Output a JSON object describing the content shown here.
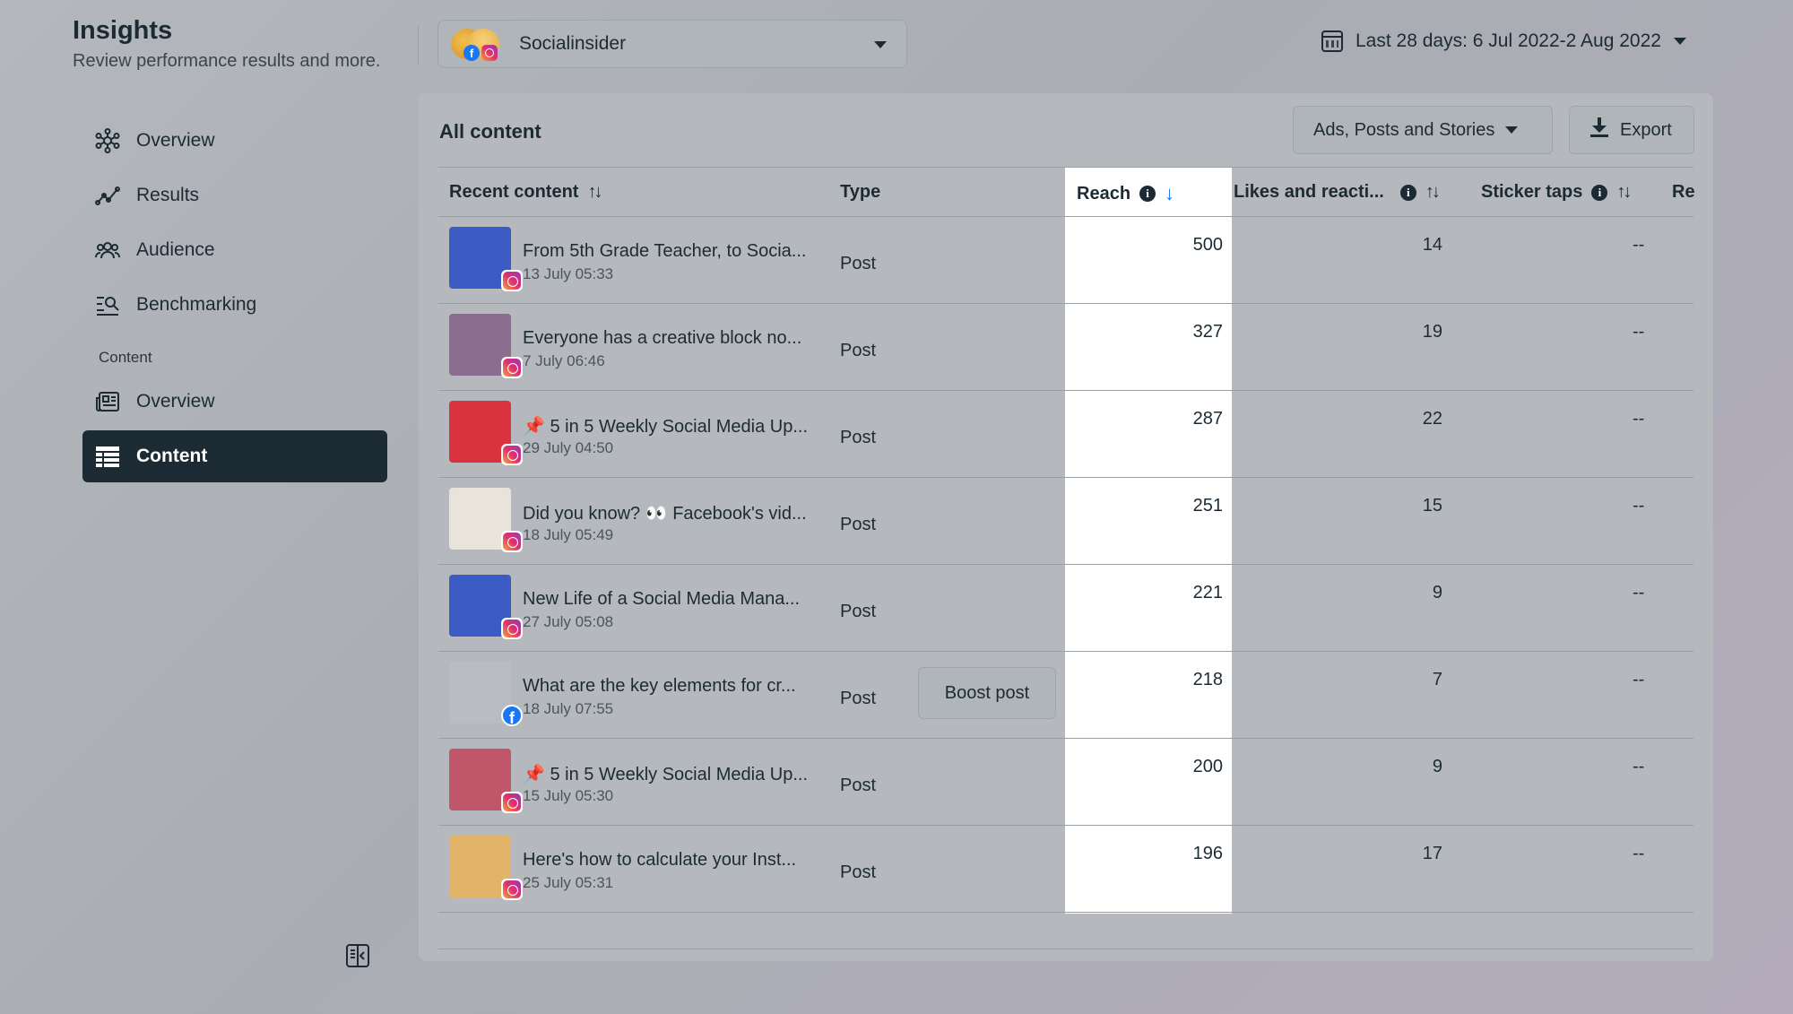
{
  "header": {
    "title": "Insights",
    "subtitle": "Review performance results and more."
  },
  "account": {
    "name": "Socialinsider"
  },
  "date_range": {
    "label": "Last 28 days: 6 Jul 2022-2 Aug 2022"
  },
  "sidebar": {
    "items": [
      {
        "label": "Overview",
        "icon": "nodes-icon"
      },
      {
        "label": "Results",
        "icon": "trend-icon"
      },
      {
        "label": "Audience",
        "icon": "people-icon"
      },
      {
        "label": "Benchmarking",
        "icon": "benchmark-icon"
      }
    ],
    "section_label": "Content",
    "content_items": [
      {
        "label": "Overview",
        "icon": "newspaper-icon"
      },
      {
        "label": "Content",
        "icon": "table-icon",
        "active": true
      }
    ]
  },
  "panel": {
    "title": "All content",
    "filter_label": "Ads, Posts and Stories",
    "export_label": "Export"
  },
  "table": {
    "columns": {
      "recent": "Recent content",
      "type": "Type",
      "reach": "Reach",
      "likes": "Likes and reacti...",
      "sticker": "Sticker taps",
      "next": "Re"
    },
    "boost_label": "Boost post",
    "rows": [
      {
        "title": "From 5th Grade Teacher, to Socia...",
        "date": "13 July 05:33",
        "type": "Post",
        "reach": "500",
        "likes": "14",
        "sticker": "--",
        "platform": "instagram",
        "thumb": "#3b5cc4"
      },
      {
        "title": "Everyone has a creative block no...",
        "date": "7 July 06:46",
        "type": "Post",
        "reach": "327",
        "likes": "19",
        "sticker": "--",
        "platform": "instagram",
        "thumb": "#8a6d8f"
      },
      {
        "title": "📌 5 in 5 Weekly Social Media Up...",
        "date": "29 July 04:50",
        "type": "Post",
        "reach": "287",
        "likes": "22",
        "sticker": "--",
        "platform": "instagram",
        "thumb": "#d8333e"
      },
      {
        "title": "Did you know? 👀 Facebook's vid...",
        "date": "18 July 05:49",
        "type": "Post",
        "reach": "251",
        "likes": "15",
        "sticker": "--",
        "platform": "instagram",
        "thumb": "#e8e4dc"
      },
      {
        "title": "New Life of a Social Media Mana...",
        "date": "27 July 05:08",
        "type": "Post",
        "reach": "221",
        "likes": "9",
        "sticker": "--",
        "platform": "instagram",
        "thumb": "#3b5cc4"
      },
      {
        "title": "What are the key elements for cr...",
        "date": "18 July 07:55",
        "type": "Post",
        "reach": "218",
        "likes": "7",
        "sticker": "--",
        "platform": "facebook",
        "thumb": "#b9bdc2",
        "boost": true
      },
      {
        "title": "📌 5 in 5 Weekly Social Media Up...",
        "date": "15 July 05:30",
        "type": "Post",
        "reach": "200",
        "likes": "9",
        "sticker": "--",
        "platform": "instagram",
        "thumb": "#c0566a"
      },
      {
        "title": "Here's how to calculate your Inst...",
        "date": "25 July 05:31",
        "type": "Post",
        "reach": "196",
        "likes": "17",
        "sticker": "--",
        "platform": "instagram",
        "thumb": "#e2b46a"
      }
    ]
  },
  "colors": {
    "sidebar_active_bg": "#1c2b33",
    "reach_highlight": "#ffffff",
    "sort_active": "#1877f2"
  }
}
